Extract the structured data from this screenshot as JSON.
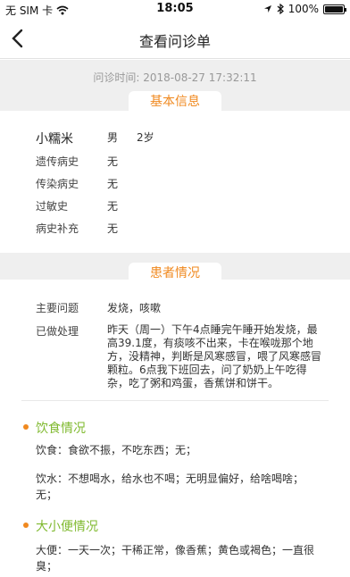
{
  "status_bar": {
    "carrier": "无 SIM 卡",
    "time": "18:05",
    "battery": "100%",
    "battery_level": 1.0,
    "icons": [
      "wifi-icon",
      "location-icon",
      "bluetooth-icon",
      "battery-icon"
    ]
  },
  "nav": {
    "title": "查看问诊单",
    "back_icon": "chevron-left-icon"
  },
  "visit_time": "问诊时间: 2018-08-27 17:32:11",
  "basic_info": {
    "tab_label": "基本信息",
    "name": "小糯米",
    "gender": "男",
    "age": "2岁",
    "rows": [
      {
        "label": "遗传病史",
        "value": "无"
      },
      {
        "label": "传染病史",
        "value": "无"
      },
      {
        "label": "过敏史",
        "value": "无"
      },
      {
        "label": "病史补充",
        "value": "无"
      }
    ]
  },
  "patient": {
    "tab_label": "患者情况",
    "main_problem_label": "主要问题",
    "main_problem": "发烧，咳嗽",
    "treatment_label": "已做处理",
    "treatment_lines": [
      "昨天（周一）下午4点睡完午睡开始发烧，最",
      "高39.1度，有痰咳不出来，卡在喉咙那个地",
      "方，没精神，判断是风寒感冒，喂了风寒感冒",
      "颗粒。6点我下班回去，问了奶奶上午吃得",
      "杂，吃了粥和鸡蛋，香蕉饼和饼干。"
    ]
  },
  "diet": {
    "title": "饮食情况",
    "food": "饮食：食欲不振，不吃东西；无；",
    "water_lines": [
      "饮水：不想喝水，给水也不喝；无明显偏好，给啥喝啥；",
      "无；"
    ]
  },
  "excretion": {
    "title": "大小便情况",
    "stool_lines": [
      "大便：一天一次；干稀正常，像香蕉；黄色或褐色；一直很",
      "臭；"
    ]
  },
  "colors": {
    "accent_orange": "#f0891f",
    "section_green": "#7fb92e",
    "band_grey": "#efefef"
  }
}
